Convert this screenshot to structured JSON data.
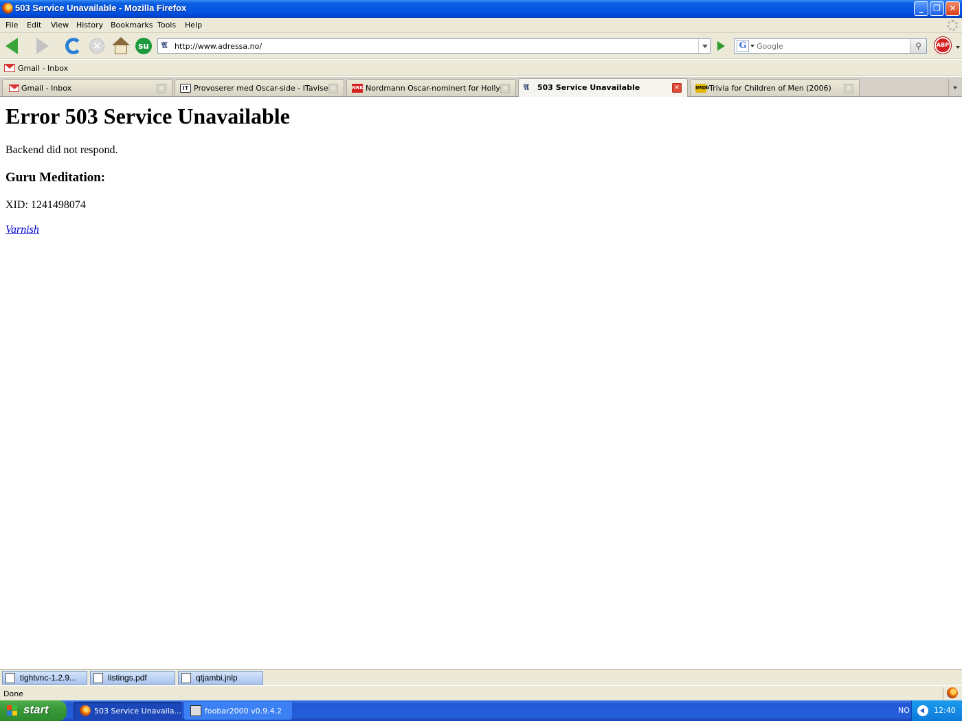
{
  "window": {
    "title": "503 Service Unavailable - Mozilla Firefox"
  },
  "menu": [
    "File",
    "Edit",
    "View",
    "History",
    "Bookmarks",
    "Tools",
    "Help"
  ],
  "toolbar": {
    "url": "http://www.adressa.no/",
    "search_placeholder": "Google",
    "abp_label": "ABP"
  },
  "bookmarks": [
    {
      "label": "Gmail - Inbox",
      "icon": "gmail-icon"
    }
  ],
  "tabs": [
    {
      "label": "Gmail - Inbox",
      "icon": "gmail-icon",
      "active": false
    },
    {
      "label": "Provoserer med Oscar-side - ITavisen",
      "icon": "itavisen-icon",
      "active": false
    },
    {
      "label": "Nordmann Oscar-nominert for Hollywo...",
      "icon": "nrk-icon",
      "active": false
    },
    {
      "label": "503 Service Unavailable",
      "icon": "adressa-icon",
      "active": true
    },
    {
      "label": "Trivia for Children of Men (2006)",
      "icon": "imdb-icon",
      "active": false
    }
  ],
  "page": {
    "heading": "Error 503 Service Unavailable",
    "message": "Backend did not respond.",
    "subheading": "Guru Meditation:",
    "xid": "XID: 1241498074",
    "link": "Varnish"
  },
  "downloads": [
    {
      "label": "tightvnc-1.2.9...",
      "icon": "vnc-file-icon"
    },
    {
      "label": "listings.pdf",
      "icon": "pdf-file-icon"
    },
    {
      "label": "qtjambi.jnlp",
      "icon": "java-file-icon"
    }
  ],
  "status": {
    "text": "Done"
  },
  "taskbar": {
    "start_label": "start",
    "tasks": [
      {
        "label": "503 Service Unavaila...",
        "icon": "firefox-icon",
        "active": true
      },
      {
        "label": "foobar2000 v0.9.4.2",
        "icon": "foobar-icon",
        "active": false
      }
    ],
    "language": "NO",
    "clock": "12:40"
  },
  "colors": {
    "titlebar": "#0656e4",
    "link": "#0000cc",
    "taskbar": "#245edb",
    "start_button": "#3a9a3a"
  }
}
